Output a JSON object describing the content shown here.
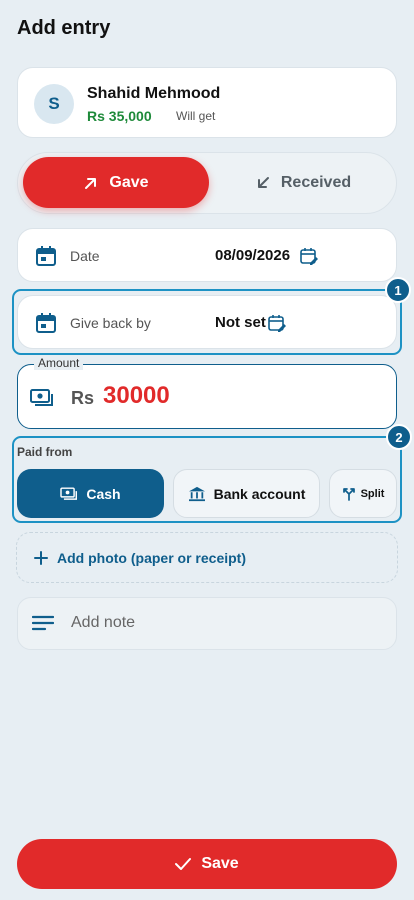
{
  "header": {
    "title": "Add entry"
  },
  "contact": {
    "initial": "S",
    "name": "Shahid Mehmood",
    "amount": "Rs 35,000",
    "status": "Will get"
  },
  "direction": {
    "gave_label": "Gave",
    "received_label": "Received",
    "selected": "Gave"
  },
  "date_field": {
    "label": "Date",
    "value": "08/09/2026"
  },
  "give_back_field": {
    "label": "Give back by",
    "value": "Not set",
    "badge": "1"
  },
  "amount": {
    "legend": "Amount",
    "currency": "Rs",
    "value": "30000"
  },
  "paid_from": {
    "label": "Paid from",
    "badge": "2",
    "options": [
      {
        "label": "Cash",
        "selected": true
      },
      {
        "label": "Bank account",
        "selected": false
      },
      {
        "label": "Split",
        "selected": false
      }
    ]
  },
  "attachments": {
    "add_photo_label": "Add photo (paper or receipt)"
  },
  "note": {
    "placeholder": "Add note"
  },
  "footer": {
    "save_label": "Save"
  },
  "colors": {
    "accent_red": "#e12a2a",
    "primary_blue": "#0f5e8c",
    "highlight_blue": "#1d92c4",
    "positive_green": "#1e8a3a",
    "background": "#e7eef3"
  }
}
